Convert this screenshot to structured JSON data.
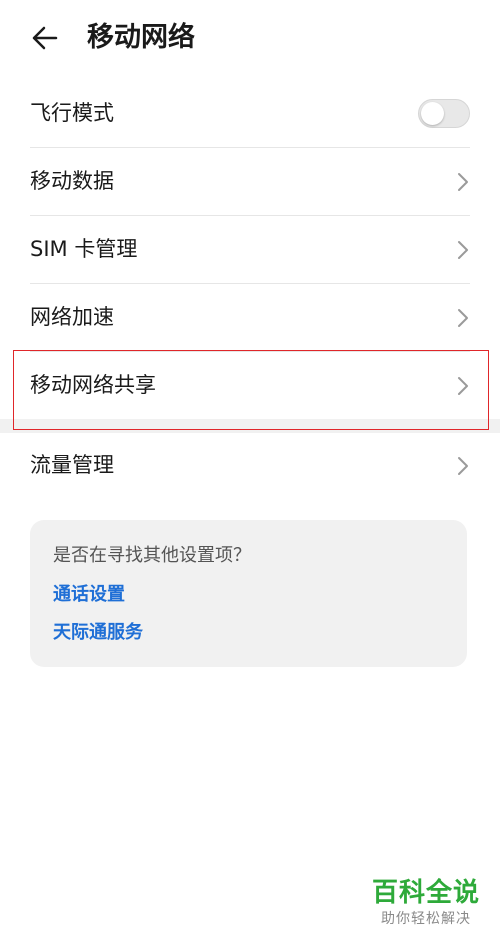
{
  "header": {
    "title": "移动网络",
    "back_icon": "arrow-left-icon"
  },
  "settings": {
    "items": [
      {
        "label": "飞行模式",
        "type": "toggle",
        "value": false
      },
      {
        "label": "移动数据",
        "type": "link"
      },
      {
        "label": "SIM 卡管理",
        "type": "link"
      },
      {
        "label": "网络加速",
        "type": "link"
      },
      {
        "label": "移动网络共享",
        "type": "link",
        "highlighted": true
      },
      {
        "label": "流量管理",
        "type": "link"
      }
    ]
  },
  "suggestions": {
    "question": "是否在寻找其他设置项？",
    "links": [
      "通话设置",
      "天际通服务"
    ]
  },
  "watermark": {
    "title": "百科全说",
    "subtitle": "助你轻松解决"
  },
  "colors": {
    "accent_link": "#1f6fd6",
    "highlight_border": "#e0262a",
    "watermark_green": "#2eaa3a"
  }
}
